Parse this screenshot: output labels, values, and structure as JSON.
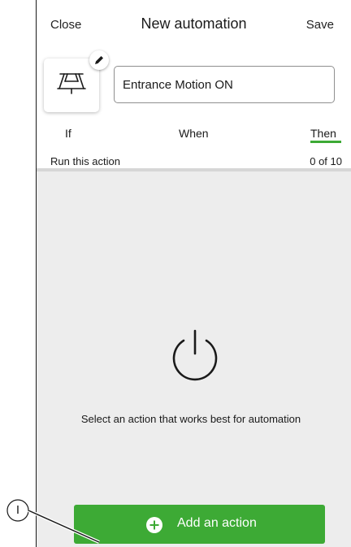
{
  "header": {
    "close_label": "Close",
    "title": "New automation",
    "save_label": "Save"
  },
  "automation": {
    "name_value": "Entrance Motion ON",
    "icon": "ceiling-lamp-icon",
    "edit_icon": "pencil-icon"
  },
  "tabs": [
    {
      "label": "If",
      "active": false
    },
    {
      "label": "When",
      "active": false
    },
    {
      "label": "Then",
      "active": true
    }
  ],
  "actions": {
    "section_label": "Run this action",
    "count": "0 of 10",
    "empty_icon": "power-icon",
    "empty_message": "Select an action that works best for automation",
    "add_button_label": "Add an action",
    "add_button_icon": "plus-circle-icon"
  },
  "callout": {
    "label": "I"
  },
  "colors": {
    "accent": "#3daa35",
    "content_bg": "#ededed"
  }
}
